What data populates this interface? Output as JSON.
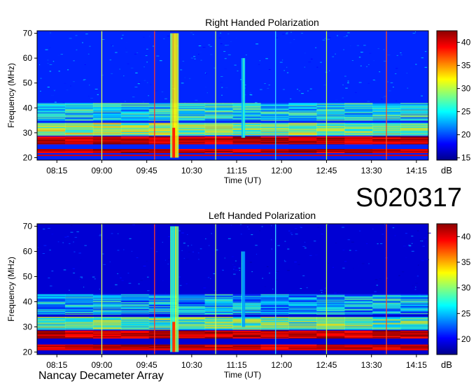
{
  "figure_code": "S020317",
  "instrument_name": "Nancay Decameter Array",
  "colors": {
    "background": "#ffffff",
    "colormap": [
      "#00008b",
      "#0000ff",
      "#0080ff",
      "#00ffff",
      "#80ff80",
      "#ffff00",
      "#ff8000",
      "#ff0000",
      "#8b0000"
    ]
  },
  "chart_data": [
    {
      "type": "heatmap",
      "title": "Right Handed Polarization",
      "xlabel": "Time (UT)",
      "ylabel": "Frequency (MHz)",
      "x_ticks": [
        "08:15",
        "09:00",
        "09:45",
        "10:30",
        "11:15",
        "12:00",
        "12:45",
        "13:30",
        "14:15"
      ],
      "x_tick_hours": [
        8.25,
        9.0,
        9.75,
        10.5,
        11.25,
        12.0,
        12.75,
        13.5,
        14.25
      ],
      "xlim_hours": [
        7.92,
        14.45
      ],
      "y_ticks": [
        20,
        30,
        40,
        50,
        60,
        70
      ],
      "ylim": [
        19,
        71
      ],
      "colorbar": {
        "label": "dB",
        "range": [
          14.5,
          42.5
        ],
        "ticks": [
          15,
          20,
          25,
          30,
          35,
          40
        ]
      },
      "vertical_markers_hours": [
        9.0,
        9.88,
        10.9,
        11.9,
        12.75,
        13.75
      ],
      "bursts": [
        {
          "hour": 10.2,
          "freq_range": [
            20,
            70
          ],
          "level": "strong"
        },
        {
          "hour": 11.35,
          "freq_range": [
            28,
            60
          ],
          "level": "moderate"
        }
      ],
      "bands_mhz": [
        {
          "freq_range": [
            22,
            23.5
          ],
          "level_db": 41
        },
        {
          "freq_range": [
            25.5,
            28.5
          ],
          "level_db": 41
        },
        {
          "freq_range": [
            29,
            34
          ],
          "level_db": 29
        },
        {
          "freq_range": [
            35,
            42
          ],
          "level_db": 25
        }
      ]
    },
    {
      "type": "heatmap",
      "title": "Left Handed Polarization",
      "xlabel": "Time (UT)",
      "ylabel": "Frequency (MHz)",
      "x_ticks": [
        "08:15",
        "09:00",
        "09:45",
        "10:30",
        "11:15",
        "12:00",
        "12:45",
        "13:30",
        "14:15"
      ],
      "x_tick_hours": [
        8.25,
        9.0,
        9.75,
        10.5,
        11.25,
        12.0,
        12.75,
        13.5,
        14.25
      ],
      "xlim_hours": [
        7.92,
        14.45
      ],
      "y_ticks": [
        20,
        30,
        40,
        50,
        60,
        70
      ],
      "ylim": [
        19,
        71
      ],
      "colorbar": {
        "label": "dB",
        "range": [
          17,
          42.5
        ],
        "ticks": [
          20,
          25,
          30,
          35,
          40
        ]
      },
      "vertical_markers_hours": [
        9.0,
        9.88,
        10.9,
        11.9,
        12.75,
        13.75
      ],
      "bursts": [
        {
          "hour": 10.2,
          "freq_range": [
            20,
            70
          ],
          "level": "strong"
        },
        {
          "hour": 11.35,
          "freq_range": [
            30,
            60
          ],
          "level": "moderate"
        }
      ],
      "bands_mhz": [
        {
          "freq_range": [
            21,
            23
          ],
          "level_db": 41
        },
        {
          "freq_range": [
            25.5,
            28.5
          ],
          "level_db": 41
        },
        {
          "freq_range": [
            29,
            34
          ],
          "level_db": 29
        },
        {
          "freq_range": [
            35,
            43
          ],
          "level_db": 25
        }
      ]
    }
  ]
}
